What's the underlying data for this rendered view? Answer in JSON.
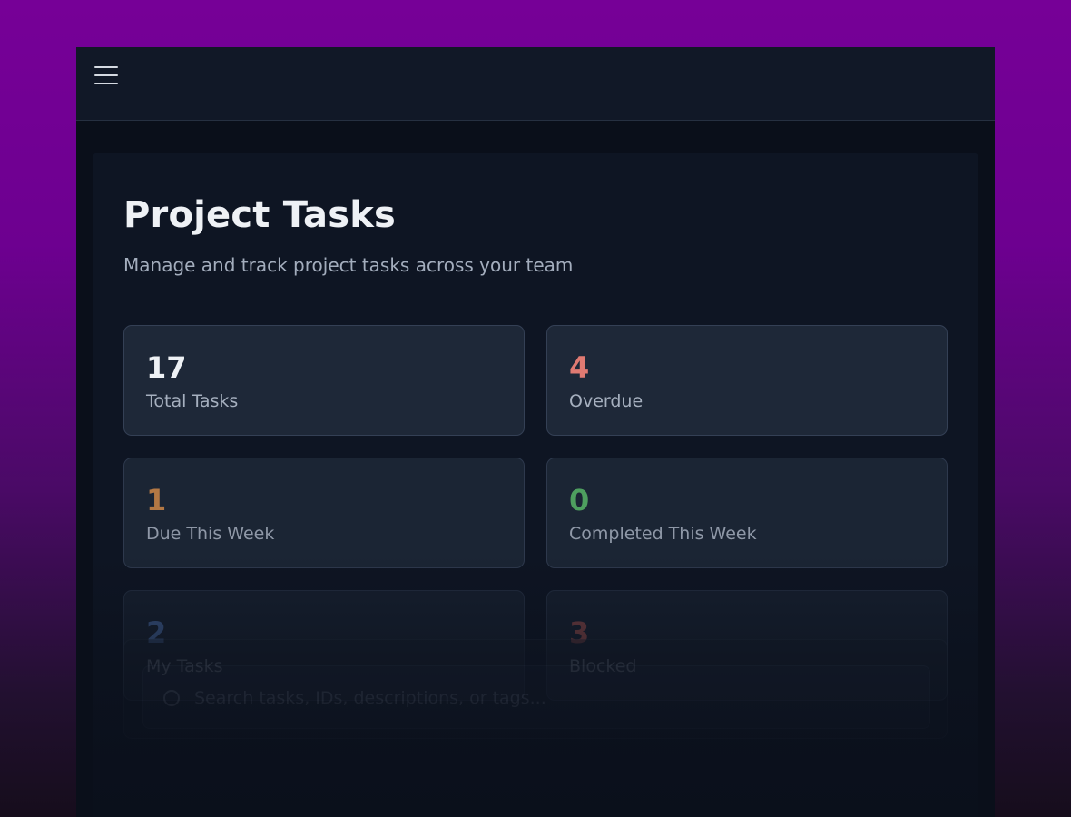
{
  "header": {
    "menu_icon": "hamburger-menu-icon"
  },
  "page": {
    "title": "Project Tasks",
    "subtitle": "Manage and track project tasks across your team"
  },
  "stats": [
    {
      "value": "17",
      "label": "Total Tasks",
      "color": "#eef1f5"
    },
    {
      "value": "4",
      "label": "Overdue",
      "color": "#e07a72"
    },
    {
      "value": "1",
      "label": "Due This Week",
      "color": "#d08a4a"
    },
    {
      "value": "0",
      "label": "Completed This Week",
      "color": "#5ab86a"
    },
    {
      "value": "2",
      "label": "My Tasks",
      "color": "#5a82c8"
    },
    {
      "value": "3",
      "label": "Blocked",
      "color": "#c0605a"
    }
  ],
  "search": {
    "placeholder": "Search tasks, IDs, descriptions, or tags...",
    "icon": "search-icon"
  },
  "colors": {
    "background_accent": "#760097",
    "panel": "#0e1523",
    "card": "#1e2838"
  }
}
